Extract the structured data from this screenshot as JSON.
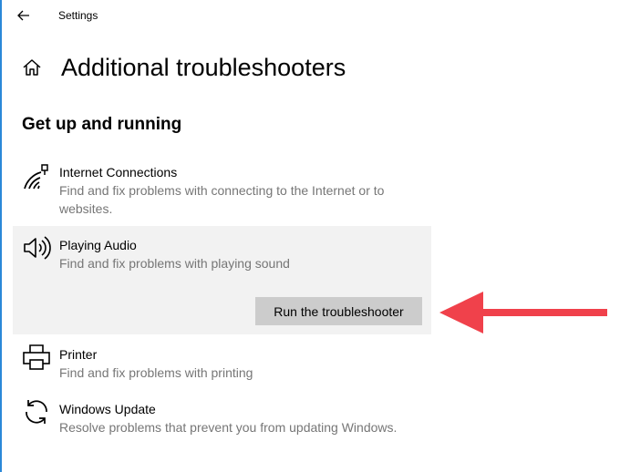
{
  "window": {
    "title": "Settings"
  },
  "page": {
    "title": "Additional troubleshooters",
    "section_title": "Get up and running"
  },
  "items": [
    {
      "name": "Internet Connections",
      "description": "Find and fix problems with connecting to the Internet or to websites.",
      "icon": "wifi-icon"
    },
    {
      "name": "Playing Audio",
      "description": "Find and fix problems with playing sound",
      "icon": "speaker-icon",
      "selected": true,
      "action_label": "Run the troubleshooter"
    },
    {
      "name": "Printer",
      "description": "Find and fix problems with printing",
      "icon": "printer-icon"
    },
    {
      "name": "Windows Update",
      "description": "Resolve problems that prevent you from updating Windows.",
      "icon": "sync-icon"
    }
  ],
  "colors": {
    "window_border": "#2b88d8",
    "selected_background": "#f2f2f2",
    "button_background": "#cccccc",
    "secondary_text": "#767676",
    "annotation_arrow": "#f0414b"
  }
}
